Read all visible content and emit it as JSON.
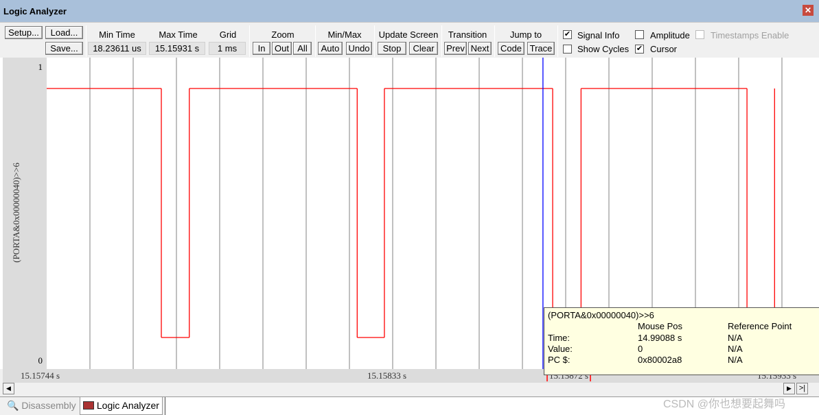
{
  "window": {
    "title": "Logic Analyzer",
    "close_icon": "close-icon"
  },
  "toolbar": {
    "setup": "Setup...",
    "load": "Load...",
    "save": "Save...",
    "min_time_label": "Min Time",
    "min_time": "18.23611 us",
    "max_time_label": "Max Time",
    "max_time": "15.15931 s",
    "grid_label": "Grid",
    "grid": "1 ms",
    "zoom_label": "Zoom",
    "zoom_in": "In",
    "zoom_out": "Out",
    "zoom_all": "All",
    "minmax_label": "Min/Max",
    "auto": "Auto",
    "undo": "Undo",
    "update_label": "Update Screen",
    "stop": "Stop",
    "clear": "Clear",
    "transition_label": "Transition",
    "prev": "Prev",
    "next": "Next",
    "jump_label": "Jump to",
    "code": "Code",
    "trace": "Trace",
    "signal_info": {
      "label": "Signal Info",
      "checked": true
    },
    "amplitude": {
      "label": "Amplitude",
      "checked": false
    },
    "timestamps": {
      "label": "Timestamps Enable",
      "checked": false,
      "disabled": true
    },
    "show_cycles": {
      "label": "Show Cycles",
      "checked": false
    },
    "cursor": {
      "label": "Cursor",
      "checked": true
    }
  },
  "chart_data": {
    "type": "line",
    "signal_name": "(PORTA&0x00000040)>>6",
    "y_ticks": [
      "1",
      "0"
    ],
    "ylim": [
      0,
      1
    ],
    "xlim": [
      15.15744,
      15.159422
    ],
    "x_tick_labels": [
      "15.15744  s",
      "15.15833  s",
      "15.15872  s",
      "15.15933  s"
    ],
    "cursor_time": 15.158717,
    "transitions": [
      {
        "t": 15.15744,
        "v": 1
      },
      {
        "t": 15.157735,
        "v": 0
      },
      {
        "t": 15.157807,
        "v": 1
      },
      {
        "t": 15.158239,
        "v": 0
      },
      {
        "t": 15.158309,
        "v": 1
      },
      {
        "t": 15.158742,
        "v": 0
      },
      {
        "t": 15.158815,
        "v": 1
      },
      {
        "t": 15.159242,
        "v": 0
      },
      {
        "t": 15.159313,
        "v": 1
      }
    ],
    "colors": {
      "signal": "#ff0000",
      "cursor": "#0000ff",
      "grid": "#808080"
    }
  },
  "tooltip": {
    "title": "(PORTA&0x00000040)>>6",
    "col_mouse": "Mouse Pos",
    "col_ref": "Reference Point",
    "rows": [
      {
        "label": "Time:",
        "mouse": "14.99088 s",
        "ref": "N/A"
      },
      {
        "label": "Value:",
        "mouse": "0",
        "ref": "N/A"
      },
      {
        "label": "PC $:",
        "mouse": "0x80002a8",
        "ref": "N/A"
      }
    ]
  },
  "tabs": [
    {
      "label": "Disassembly",
      "active": false
    },
    {
      "label": "Logic Analyzer",
      "active": true
    }
  ],
  "watermark": "CSDN @你也想要起舞吗"
}
